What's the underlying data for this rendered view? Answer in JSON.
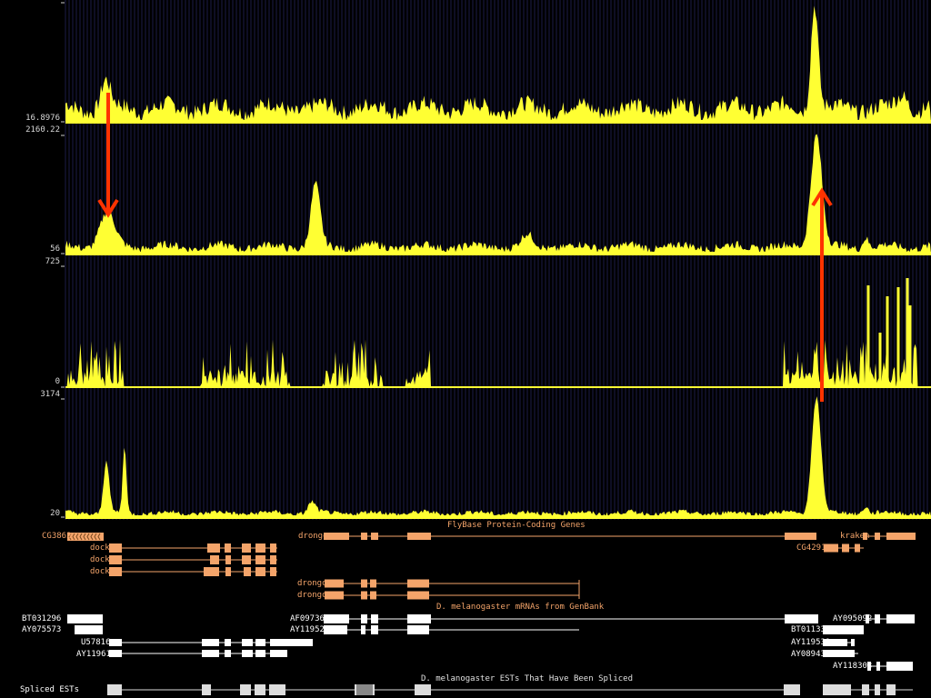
{
  "wiggle_tracks": [
    {
      "id": "t1",
      "ymax_label": "",
      "ymin_label": "16.8976"
    },
    {
      "id": "t2",
      "ymax_label": "2160.22",
      "ymin_label": "56"
    },
    {
      "id": "t3",
      "ymax_label": "725",
      "ymin_label": "0"
    },
    {
      "id": "t4",
      "ymax_label": "3174",
      "ymin_label": "20"
    }
  ],
  "colors": {
    "signal": "#ffff33",
    "gene": "#f4a46a",
    "mrna": "#ffffff",
    "arrow": "#ff3300",
    "grid": "#1c1c48"
  },
  "gene_track": {
    "title": "FlyBase Protein-Coding Genes",
    "labels": {
      "cg3862": "CG3862",
      "drongo": "drongo",
      "kraken": "kraken",
      "dock1": "dock",
      "dock2": "dock",
      "dock3": "dock",
      "cg4291": "CG4291",
      "drongo2": "drongo",
      "drongo3": "drongo"
    }
  },
  "mrna_track": {
    "title": "D. melanogaster mRNAs from GenBank",
    "labels": {
      "bt031296": "BT031296",
      "ay075573": "AY075573",
      "af097364": "AF097364",
      "ay119526": "AY119526",
      "u57816": "U57816",
      "ay119614": "AY119614",
      "ay095092": "AY095092",
      "bt011334": "BT011334",
      "ay119531": "AY119531",
      "ay089433": "AY089433",
      "ay118303": "AY118303"
    }
  },
  "est_track": {
    "title": "D. melanogaster ESTs That Have Been Spliced",
    "row_label": "Spliced ESTs"
  }
}
